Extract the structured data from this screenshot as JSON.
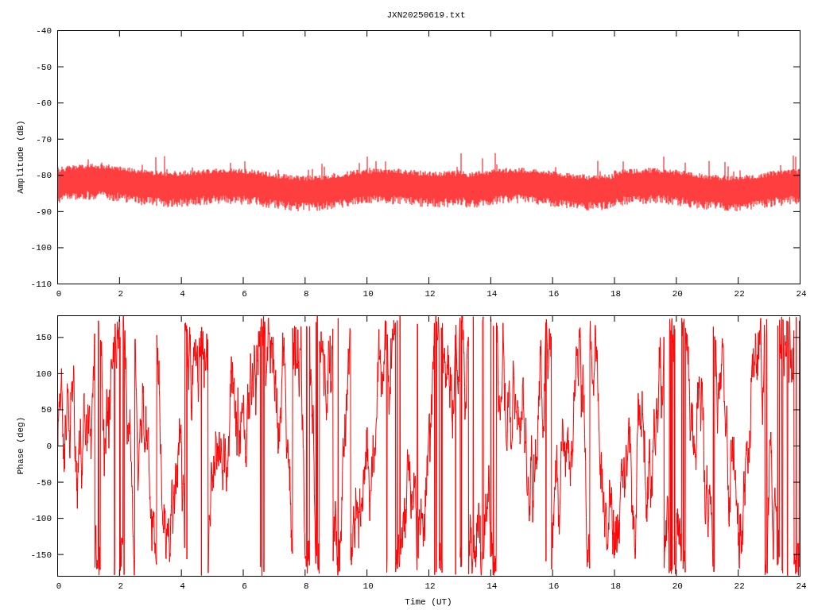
{
  "title": "JXN20250619.txt",
  "plots": [
    {
      "kind": "amplitude",
      "ylabel": "Amplitude (dB)",
      "yticks": [
        "-40",
        "-50",
        "-60",
        "-70",
        "-80",
        "-90",
        "-100",
        "-110"
      ],
      "xticks": [
        "0",
        "2",
        "4",
        "6",
        "8",
        "10",
        "12",
        "14",
        "16",
        "18",
        "20",
        "22",
        "24"
      ]
    },
    {
      "kind": "phase",
      "ylabel": "Phase (deg)",
      "yticks": [
        "150",
        "100",
        "50",
        "0",
        "-50",
        "-100",
        "-150"
      ],
      "xticks": [
        "0",
        "2",
        "4",
        "6",
        "8",
        "10",
        "12",
        "14",
        "16",
        "18",
        "20",
        "22",
        "24"
      ]
    }
  ],
  "xlabel": "Time (UT)"
}
